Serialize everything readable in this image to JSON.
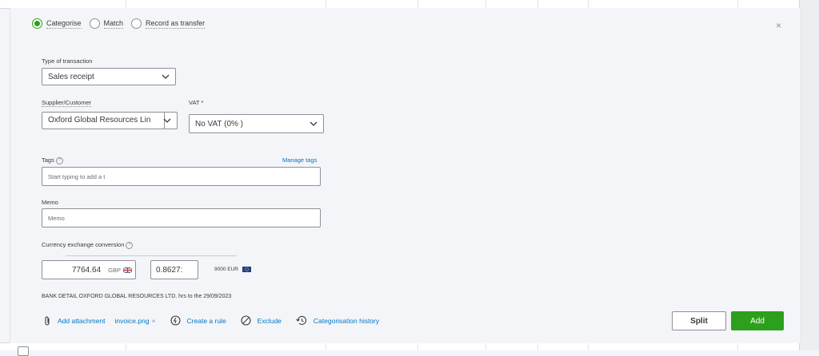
{
  "categorise_options": [
    {
      "label": "Categorise",
      "selected": true
    },
    {
      "label": "Match",
      "selected": false
    },
    {
      "label": "Record as transfer",
      "selected": false
    }
  ],
  "close_label": "×",
  "type_of_transaction": {
    "label": "Type of transaction",
    "value": "Sales receipt"
  },
  "supplier_customer": {
    "label": "Supplier/Customer",
    "value": "Oxford Global Resources Lin"
  },
  "vat": {
    "label": "VAT *",
    "value": "No VAT (0% )"
  },
  "tags": {
    "label": "Tags",
    "help": "?",
    "manage_link": "Manage tags",
    "value": "Start typing to add a t"
  },
  "memo": {
    "label": "Memo",
    "value": "Memo"
  },
  "currency": {
    "label": "Currency exchange conversion",
    "help": "?",
    "home_amount": "7764.64",
    "home_currency": "GBP",
    "rate": "0.8627:",
    "foreign_amount": "9000",
    "foreign_currency": "EUR"
  },
  "bank_detail": "BANK DETAIL OXFORD GLOBAL RESOURCES LTD. hrs to the 29/09/2023",
  "actions": {
    "add_attachment": "Add attachment",
    "attachment_file": "invoice.png",
    "remove": "×",
    "create_rule": "Create a rule",
    "exclude": "Exclude",
    "history": "Categorisation history"
  },
  "buttons": {
    "split": "Split",
    "add": "Add"
  },
  "colors": {
    "accent_green": "#2ca01c",
    "link_blue": "#0077c5"
  }
}
